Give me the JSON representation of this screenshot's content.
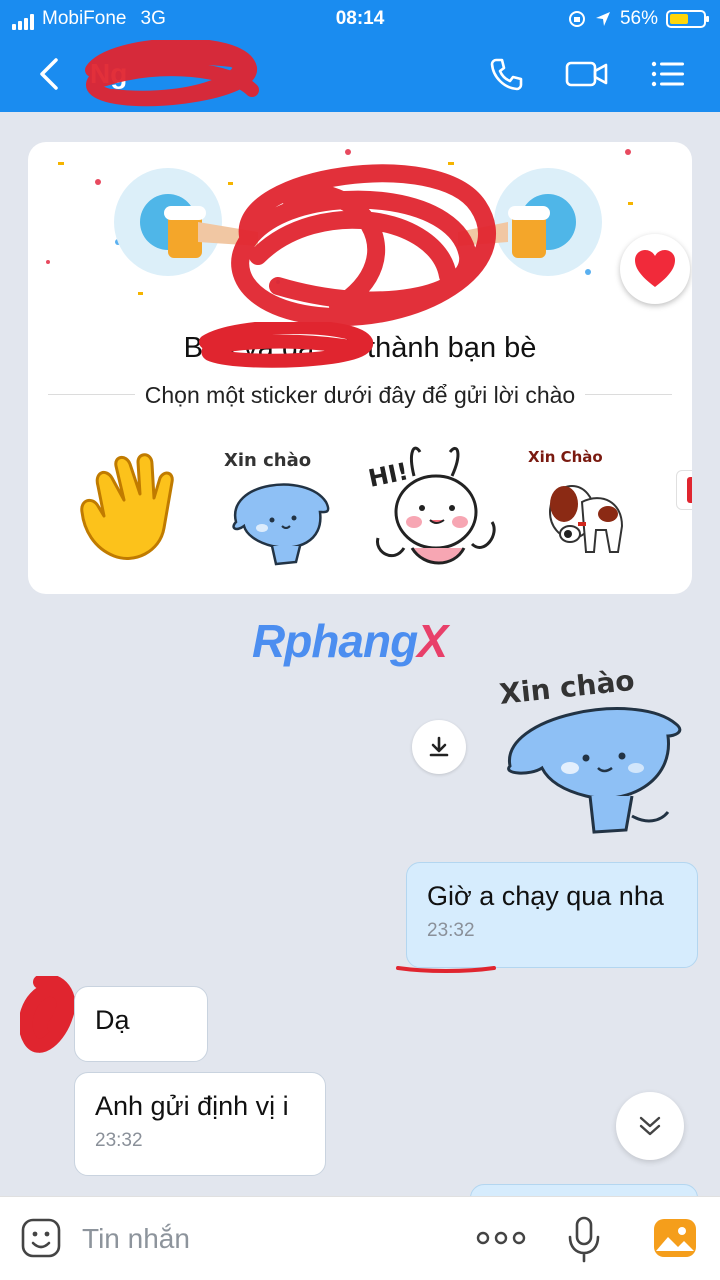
{
  "status": {
    "carrier": "MobiFone",
    "network": "3G",
    "time": "08:14",
    "battery": "56%",
    "battery_level": 0.56
  },
  "header": {
    "contact_name": "Ng",
    "icons": [
      "back-arrow-icon",
      "phone-icon",
      "video-call-icon",
      "menu-list-icon"
    ]
  },
  "friend_card": {
    "title": "Bạn và                 đã trở thành bạn bè",
    "subtitle": "Chọn một sticker dưới đây để gửi lời chào",
    "stickers": [
      "waving-hand",
      "Xin chào",
      "HI!",
      "Xin Chào"
    ]
  },
  "watermark": {
    "main": "Rphang",
    "tail": "X"
  },
  "sticker_message": {
    "text": "Xin chào"
  },
  "messages": [
    {
      "side": "me",
      "text": "Giờ a chạy qua nha",
      "time": "23:32"
    },
    {
      "side": "other",
      "text": "Dạ",
      "time": ""
    },
    {
      "side": "other",
      "text": "Anh gửi định vị i",
      "time": "23:32"
    }
  ],
  "composer": {
    "placeholder": "Tin nhắn"
  },
  "colors": {
    "header_blue": "#1a8cf0",
    "my_bubble": "#d6ecfd",
    "chat_bg": "#e2e6ee",
    "redact_red": "#e0252f"
  }
}
